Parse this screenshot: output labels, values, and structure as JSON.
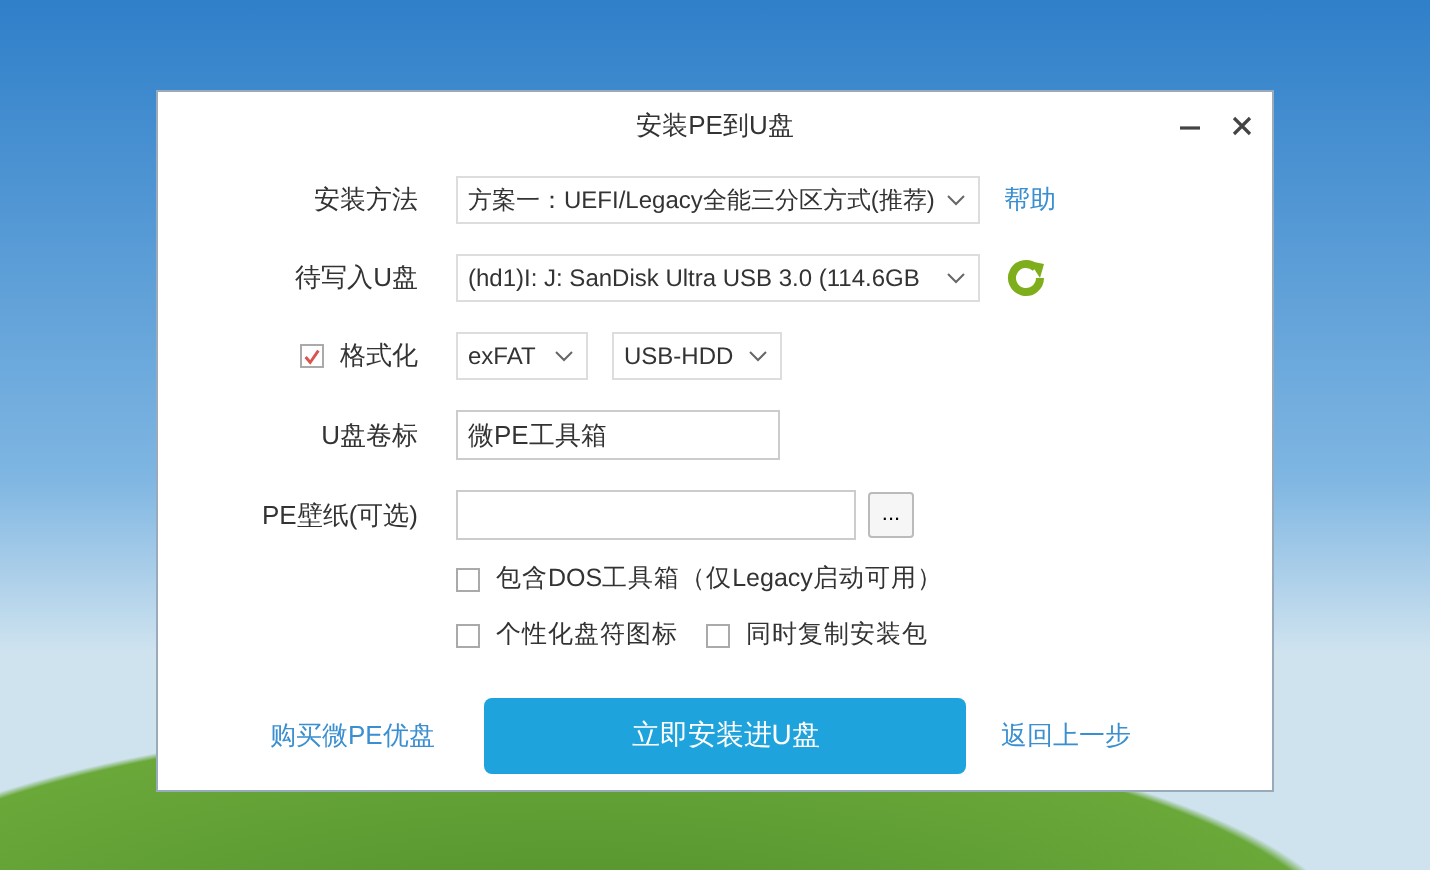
{
  "window": {
    "title": "安装PE到U盘"
  },
  "install_method": {
    "label": "安装方法",
    "value": "方案一：UEFI/Legacy全能三分区方式(推荐)",
    "help_link": "帮助"
  },
  "drive": {
    "label": "待写入U盘",
    "value": "(hd1)I: J: SanDisk Ultra USB 3.0 (114.6GB"
  },
  "format": {
    "label": "格式化",
    "checked": true,
    "filesystem": "exFAT",
    "mode": "USB-HDD"
  },
  "volume_label": {
    "label": "U盘卷标",
    "value": "微PE工具箱"
  },
  "wallpaper": {
    "label": "PE壁纸(可选)",
    "browse_button": "..."
  },
  "option_rows": [
    [
      {
        "label": "包含DOS工具箱（仅Legacy启动可用）",
        "checked": false
      }
    ],
    [
      {
        "label": "个性化盘符图标",
        "checked": false
      },
      {
        "label": "同时复制安装包",
        "checked": false
      }
    ]
  ],
  "footer": {
    "buy_link": "购买微PE优盘",
    "install_button": "立即安装进U盘",
    "back_link": "返回上一步"
  }
}
